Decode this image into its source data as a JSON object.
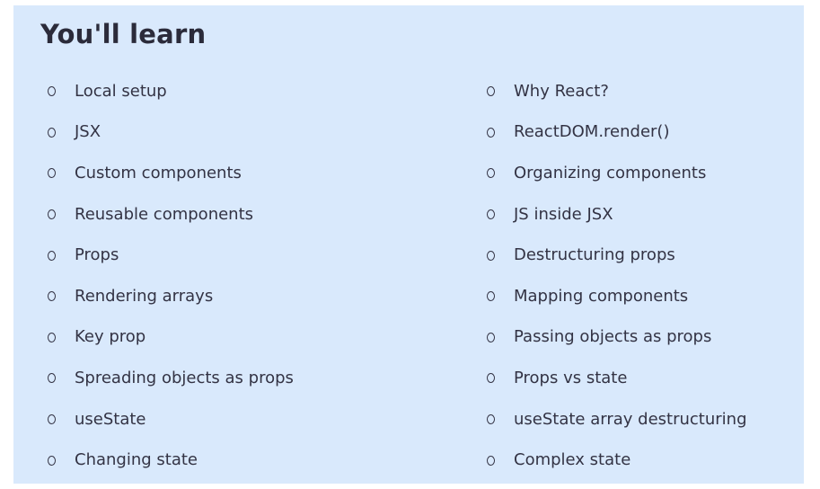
{
  "section": {
    "title": "You'll learn"
  },
  "left_column": [
    {
      "label": "Local setup"
    },
    {
      "label": "JSX"
    },
    {
      "label": "Custom components"
    },
    {
      "label": "Reusable components"
    },
    {
      "label": "Props"
    },
    {
      "label": "Rendering arrays"
    },
    {
      "label": "Key prop"
    },
    {
      "label": "Spreading objects as props"
    },
    {
      "label": "useState"
    },
    {
      "label": "Changing state"
    }
  ],
  "right_column": [
    {
      "label": "Why React?"
    },
    {
      "label": "ReactDOM.render()"
    },
    {
      "label": "Organizing components"
    },
    {
      "label": "JS inside JSX"
    },
    {
      "label": "Destructuring props"
    },
    {
      "label": "Mapping components"
    },
    {
      "label": "Passing objects as props"
    },
    {
      "label": "Props vs state"
    },
    {
      "label": "useState array destructuring"
    },
    {
      "label": "Complex state"
    }
  ],
  "icons": {
    "bullet": "circle-outline-icon"
  },
  "colors": {
    "panel_background": "#d9e9fc",
    "text": "#333344",
    "title": "#2b2b3a"
  }
}
